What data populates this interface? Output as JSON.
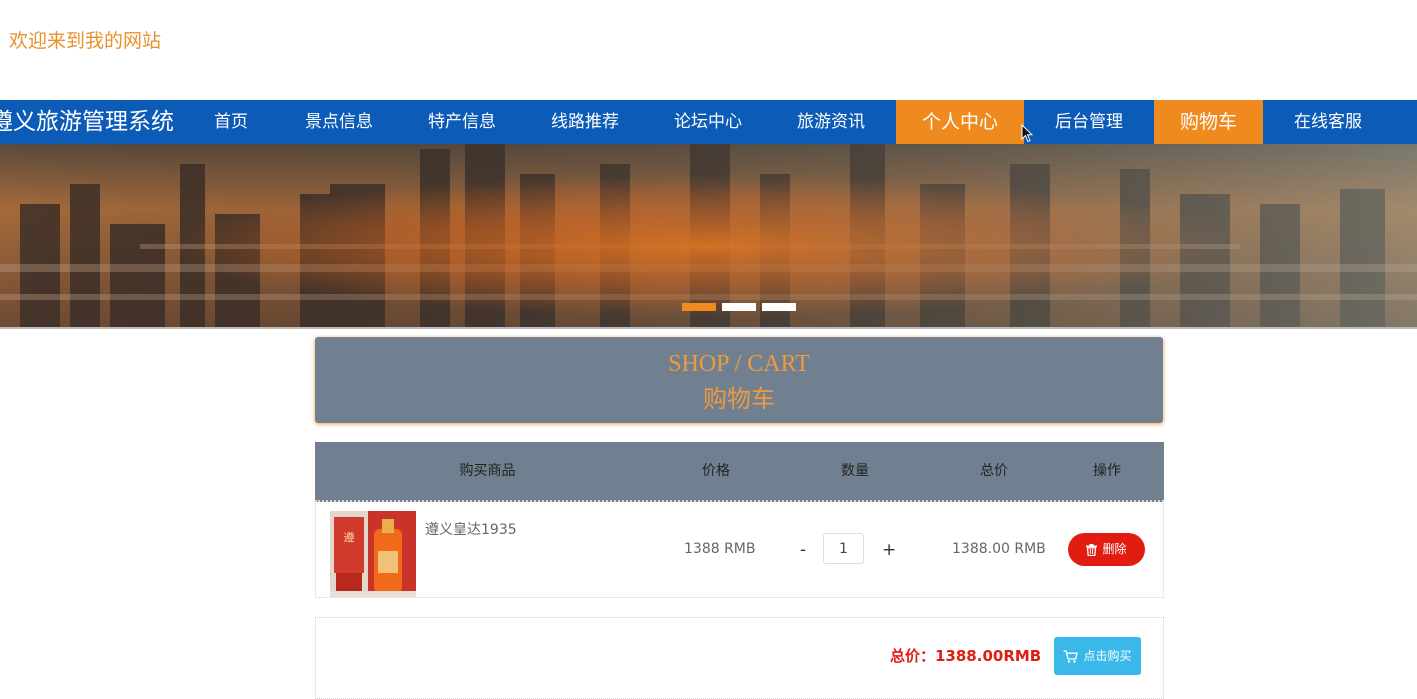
{
  "header": {
    "welcome": "欢迎来到我的网站"
  },
  "nav": {
    "brand": "遵义旅游管理系统",
    "items": [
      {
        "label": "首页"
      },
      {
        "label": "景点信息"
      },
      {
        "label": "特产信息"
      },
      {
        "label": "线路推荐"
      },
      {
        "label": "论坛中心"
      },
      {
        "label": "旅游资讯"
      },
      {
        "label": "个人中心"
      },
      {
        "label": "后台管理"
      },
      {
        "label": "购物车"
      },
      {
        "label": "在线客服"
      }
    ],
    "active_items": [
      "个人中心",
      "购物车"
    ]
  },
  "banner": {
    "slide_count": 3,
    "active_slide": 1
  },
  "cart": {
    "title_en": "SHOP / CART",
    "title_cn": "购物车",
    "columns": [
      "购买商品",
      "价格",
      "数量",
      "总价",
      "操作"
    ],
    "items": [
      {
        "name": "遵义皇达1935",
        "price": "1388 RMB",
        "quantity": "1",
        "subtotal": "1388.00 RMB",
        "delete_label": "删除",
        "minus": "-",
        "plus": "+"
      }
    ],
    "total": "总价：1388.00RMB",
    "buy_label": "点击购买"
  },
  "colors": {
    "nav_bg": "#0c5bb7",
    "accent": "#ef8a1e",
    "header_bg": "#708090",
    "danger": "#e01d10",
    "buy_button": "#3ab8ea"
  },
  "icons": [
    "trash-icon",
    "cart-icon",
    "mouse-cursor-icon"
  ]
}
